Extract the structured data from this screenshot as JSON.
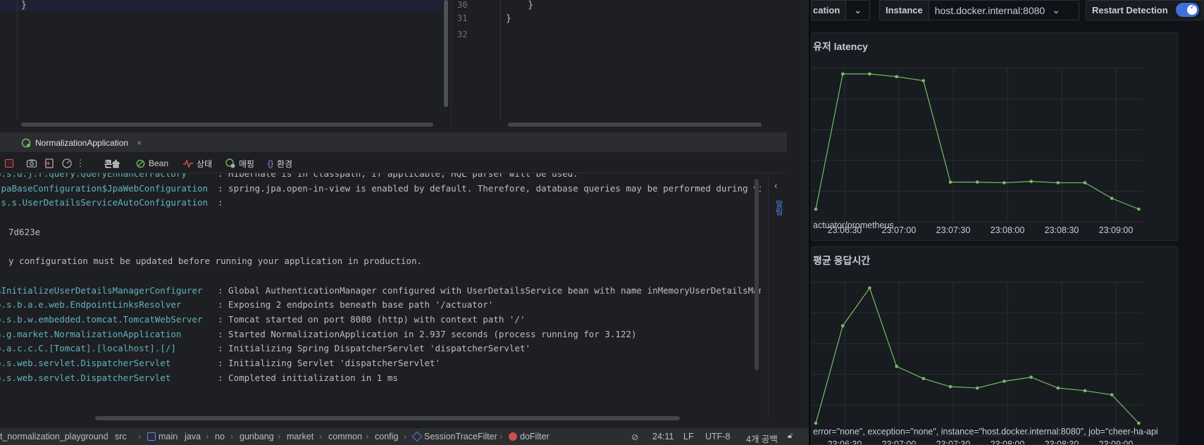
{
  "ide": {
    "editor_left": {
      "line_text": "}"
    },
    "editor_right": {
      "line_numbers": [
        "30",
        "31",
        "32"
      ],
      "lines": [
        "    }",
        "}",
        ""
      ]
    },
    "run_tab": {
      "label": "NormalizationApplication",
      "close": "×"
    },
    "console_tabs": [
      {
        "label": "콘솔",
        "icon": "console-icon"
      },
      {
        "label": "Bean",
        "icon": "bean-icon"
      },
      {
        "label": "상태",
        "icon": "health-icon"
      },
      {
        "label": "매핑",
        "icon": "mapping-icon"
      },
      {
        "label": "환경",
        "icon": "braces-icon"
      }
    ],
    "right_strip_label": "알림",
    "log": [
      {
        "logger": "o.s.d.j.r.query.QueryEnhancerFactory",
        "u": "QueryEnhancerFactory",
        "message": ": Hibernate is in classpath; If applicable, HQL parser will be used."
      },
      {
        "logger": "JpaBaseConfiguration$JpaWebConfiguration",
        "u": "",
        "message": ": spring.jpa.open-in-view is enabled by default. Therefore, database queries may be performed during view"
      },
      {
        "logger": ".s.s.UserDetailsServiceAutoConfiguration",
        "u": "UserDetailsServiceAutoConfiguration",
        "message": ":"
      },
      {
        "logger": "",
        "u": "",
        "message": ""
      },
      {
        "logger": "",
        "u": "",
        "message": "7d623e"
      },
      {
        "logger": "",
        "u": "",
        "message": ""
      },
      {
        "logger": "",
        "u": "",
        "message": "y configuration must be updated before running your application in production."
      },
      {
        "logger": "",
        "u": "",
        "message": ""
      },
      {
        "logger": "$InitializeUserDetailsManagerConfigurer",
        "u": "",
        "message": ": Global AuthenticationManager configured with UserDetailsService bean with name inMemoryUserDetailsManager"
      },
      {
        "logger": "o.s.b.a.e.web.EndpointLinksResolver",
        "u": "EndpointLinksResolver",
        "message": ": Exposing 2 endpoints beneath base path '/actuator'"
      },
      {
        "logger": "o.s.b.w.embedded.tomcat.TomcatWebServer",
        "u": "TomcatWebServer",
        "message": ": Tomcat started on port 8080 (http) with context path '/'"
      },
      {
        "logger": "n.g.market.NormalizationApplication",
        "u": "NormalizationApplication",
        "message": ": Started NormalizationApplication in 2.937 seconds (process running for 3.122)"
      },
      {
        "logger": "o.a.c.c.C.[Tomcat].[localhost].[/]",
        "u": "",
        "message": ": Initializing Spring DispatcherServlet 'dispatcherServlet'"
      },
      {
        "logger": "o.s.web.servlet.DispatcherServlet",
        "u": "DispatcherServlet",
        "message": ": Initializing Servlet 'dispatcherServlet'"
      },
      {
        "logger": "o.s.web.servlet.DispatcherServlet",
        "u": "DispatcherServlet",
        "message": ": Completed initialization in 1 ms"
      }
    ],
    "breadcrumb": [
      "t_normalization_playground",
      "src",
      "main",
      "java",
      "no",
      "gunbang",
      "market",
      "common",
      "config",
      "SessionTraceFilter",
      "doFilter"
    ],
    "status": {
      "position": "24:11",
      "line_sep": "LF",
      "encoding": "UTF-8",
      "indent": "4개 공백"
    }
  },
  "grafana": {
    "controls": {
      "application_label": "cation",
      "instance_label": "Instance",
      "instance_value": "host.docker.internal:8080",
      "restart_label": "Restart Detection",
      "restart_enabled": true
    },
    "panels": [
      {
        "title": "유저 latency",
        "legend": "actuator/prometheus"
      },
      {
        "title": "평균 응답시간",
        "legend": "error=\"none\", exception=\"none\", instance=\"host.docker.internal:8080\", job=\"cheer-ha-api"
      }
    ],
    "accent_color": "#73bf69"
  },
  "chart_data": [
    {
      "type": "line",
      "title": "유저 latency",
      "x": [
        "23:06:15",
        "23:06:25",
        "23:06:40",
        "23:06:55",
        "23:07:10",
        "23:07:25",
        "23:07:40",
        "23:07:55",
        "23:08:10",
        "23:08:25",
        "23:08:40",
        "23:08:55",
        "23:09:10"
      ],
      "xticks": [
        "23:06:30",
        "23:07:00",
        "23:07:30",
        "23:08:00",
        "23:08:30",
        "23:09:00"
      ],
      "series": [
        {
          "values": [
            0.0,
            1.0,
            1.0,
            0.98,
            0.95,
            0.2,
            0.2,
            0.195,
            0.205,
            0.195,
            0.195,
            0.08,
            0.0
          ]
        }
      ],
      "grid": true,
      "color": "#73bf69"
    },
    {
      "type": "line",
      "title": "평균 응답시간",
      "x": [
        "23:06:15",
        "23:06:25",
        "23:06:40",
        "23:06:55",
        "23:07:10",
        "23:07:25",
        "23:07:40",
        "23:07:55",
        "23:08:10",
        "23:08:25",
        "23:08:40",
        "23:08:55",
        "23:09:10"
      ],
      "xticks": [
        "23:06:30",
        "23:07:00",
        "23:07:30",
        "23:08:00",
        "23:08:30",
        "23:09:00"
      ],
      "series": [
        {
          "values": [
            0.0,
            0.72,
            1.0,
            0.42,
            0.33,
            0.27,
            0.26,
            0.31,
            0.34,
            0.26,
            0.24,
            0.21,
            0.0
          ]
        }
      ],
      "grid": true,
      "color": "#73bf69"
    }
  ]
}
